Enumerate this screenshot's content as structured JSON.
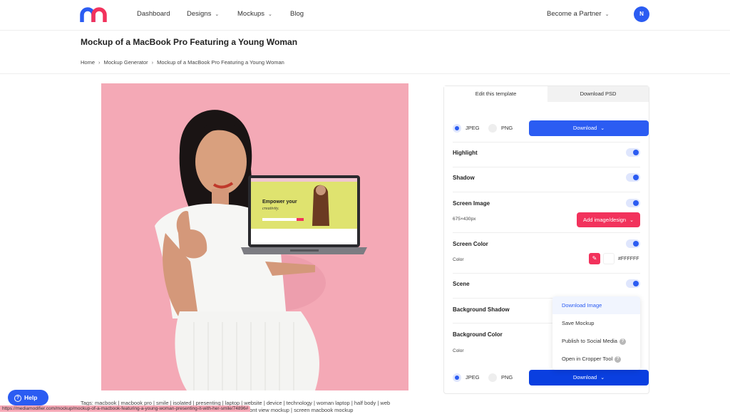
{
  "nav": {
    "logo": "mediamodifier-logo",
    "items": [
      {
        "label": "Dashboard",
        "has_dropdown": false
      },
      {
        "label": "Designs",
        "has_dropdown": true
      },
      {
        "label": "Mockups",
        "has_dropdown": true
      },
      {
        "label": "Blog",
        "has_dropdown": false
      }
    ],
    "partner_label": "Become a Partner",
    "avatar_initial": "N"
  },
  "page": {
    "title": "Mockup of a MacBook Pro Featuring a Young Woman",
    "breadcrumb": [
      "Home",
      "Mockup Generator",
      "Mockup of a MacBook Pro Featuring a Young Woman"
    ],
    "breadcrumb_separator": "›"
  },
  "preview": {
    "description": "Young woman in white outfit giving thumbs up holding a MacBook Pro on pink background",
    "background_color": "#f4a9b6",
    "screen_headline": "Empower your",
    "screen_subheadline": "creativity."
  },
  "panel": {
    "tabs": [
      {
        "label": "Edit this template",
        "active": true
      },
      {
        "label": "Download PSD",
        "active": false
      }
    ],
    "format_top": {
      "options": [
        "JPEG",
        "PNG"
      ],
      "selected": "JPEG",
      "download_label": "Download"
    },
    "settings": [
      {
        "label": "Highlight",
        "enabled": true
      },
      {
        "label": "Shadow",
        "enabled": true
      },
      {
        "label": "Screen Image",
        "enabled": true,
        "size": "675×430px",
        "button_label": "Add image/design"
      },
      {
        "label": "Screen Color",
        "enabled": true,
        "sub_label": "Color",
        "hex": "#FFFFFF"
      },
      {
        "label": "Scene",
        "enabled": true
      },
      {
        "label": "Background Shadow"
      },
      {
        "label": "Background Color",
        "sub_label": "Color"
      }
    ],
    "format_bottom": {
      "options": [
        "JPEG",
        "PNG"
      ],
      "selected": "JPEG",
      "download_label": "Download"
    },
    "dropdown_menu": [
      {
        "label": "Download Image",
        "active": true,
        "help": false
      },
      {
        "label": "Save Mockup",
        "active": false,
        "help": false
      },
      {
        "label": "Publish to Social Media",
        "active": false,
        "help": true
      },
      {
        "label": "Open in Cropper Tool",
        "active": false,
        "help": true
      }
    ]
  },
  "colors": {
    "primary": "#2b5cf2",
    "accent_red": "#f2325c",
    "preview_bg": "#f4a9b6"
  },
  "help_label": "Help",
  "tags_text": "Tags: macbook | macbook pro | smile | isolated | presenting | laptop | website | device | technology | woman laptop | half body | web",
  "tags_text_line2": "...acbook front view mockup | screen macbook mockup",
  "status_url": "https://mediamodifier.com/mockup/mockup-of-a-macbook-featuring-a-young-woman-presenting-it-with-her-smile/74896#"
}
